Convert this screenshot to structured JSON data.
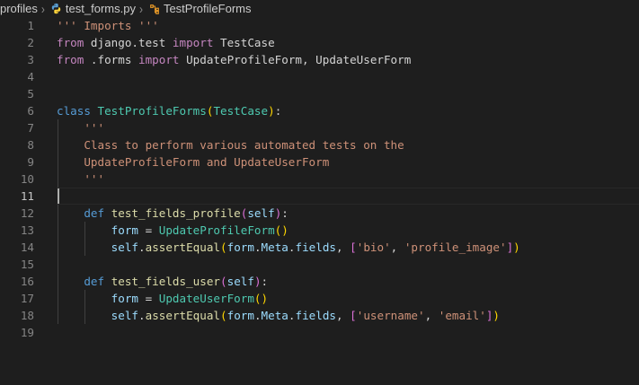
{
  "breadcrumb": {
    "folder": "profiles",
    "file": "test_forms.py",
    "symbol": "TestProfileForms"
  },
  "icons": {
    "separator": "chevron-right-icon",
    "file": "python-file-icon",
    "symbol": "class-symbol-icon"
  },
  "colors": {
    "background": "#1e1e1e",
    "keyword": "#569cd6",
    "import_keyword": "#c586c0",
    "class_name": "#4ec9b0",
    "function": "#dcdcaa",
    "string": "#ce9178",
    "variable": "#9cdcfe"
  },
  "editor": {
    "current_line": 11,
    "lines": [
      {
        "n": "1",
        "tokens": [
          {
            "t": "''' Imports '''",
            "c": "str"
          }
        ]
      },
      {
        "n": "2",
        "tokens": [
          {
            "t": "from",
            "c": "kw2"
          },
          {
            "t": " django.test "
          },
          {
            "t": "import",
            "c": "kw2"
          },
          {
            "t": " TestCase"
          }
        ]
      },
      {
        "n": "3",
        "tokens": [
          {
            "t": "from",
            "c": "kw2"
          },
          {
            "t": " .forms "
          },
          {
            "t": "import",
            "c": "kw2"
          },
          {
            "t": " UpdateProfileForm, UpdateUserForm"
          }
        ]
      },
      {
        "n": "4",
        "tokens": []
      },
      {
        "n": "5",
        "tokens": []
      },
      {
        "n": "6",
        "tokens": [
          {
            "t": "class",
            "c": "kw"
          },
          {
            "t": " "
          },
          {
            "t": "TestProfileForms",
            "c": "cls"
          },
          {
            "t": "(",
            "c": "b1"
          },
          {
            "t": "TestCase",
            "c": "cls"
          },
          {
            "t": ")",
            "c": "b1"
          },
          {
            "t": ":"
          }
        ]
      },
      {
        "n": "7",
        "tokens": [
          {
            "t": "    "
          },
          {
            "t": "'''",
            "c": "str"
          }
        ]
      },
      {
        "n": "8",
        "tokens": [
          {
            "t": "    "
          },
          {
            "t": "Class to perform various automated tests on the",
            "c": "str"
          }
        ]
      },
      {
        "n": "9",
        "tokens": [
          {
            "t": "    "
          },
          {
            "t": "UpdateProfileForm and UpdateUserForm",
            "c": "str"
          }
        ]
      },
      {
        "n": "10",
        "tokens": [
          {
            "t": "    "
          },
          {
            "t": "'''",
            "c": "str"
          }
        ]
      },
      {
        "n": "11",
        "tokens": []
      },
      {
        "n": "12",
        "tokens": [
          {
            "t": "    "
          },
          {
            "t": "def",
            "c": "kw"
          },
          {
            "t": " "
          },
          {
            "t": "test_fields_profile",
            "c": "fn"
          },
          {
            "t": "(",
            "c": "b2"
          },
          {
            "t": "self",
            "c": "var"
          },
          {
            "t": ")",
            "c": "b2"
          },
          {
            "t": ":"
          }
        ]
      },
      {
        "n": "13",
        "tokens": [
          {
            "t": "        "
          },
          {
            "t": "form",
            "c": "var"
          },
          {
            "t": " = "
          },
          {
            "t": "UpdateProfileForm",
            "c": "cls"
          },
          {
            "t": "()",
            "c": "b1"
          }
        ]
      },
      {
        "n": "14",
        "tokens": [
          {
            "t": "        "
          },
          {
            "t": "self",
            "c": "var"
          },
          {
            "t": "."
          },
          {
            "t": "assertEqual",
            "c": "fn"
          },
          {
            "t": "(",
            "c": "b1"
          },
          {
            "t": "form",
            "c": "var"
          },
          {
            "t": "."
          },
          {
            "t": "Meta",
            "c": "var"
          },
          {
            "t": "."
          },
          {
            "t": "fields",
            "c": "var"
          },
          {
            "t": ", "
          },
          {
            "t": "[",
            "c": "b2"
          },
          {
            "t": "'bio'",
            "c": "str"
          },
          {
            "t": ", "
          },
          {
            "t": "'profile_image'",
            "c": "str"
          },
          {
            "t": "]",
            "c": "b2"
          },
          {
            "t": ")",
            "c": "b1"
          }
        ]
      },
      {
        "n": "15",
        "tokens": []
      },
      {
        "n": "16",
        "tokens": [
          {
            "t": "    "
          },
          {
            "t": "def",
            "c": "kw"
          },
          {
            "t": " "
          },
          {
            "t": "test_fields_user",
            "c": "fn"
          },
          {
            "t": "(",
            "c": "b2"
          },
          {
            "t": "self",
            "c": "var"
          },
          {
            "t": ")",
            "c": "b2"
          },
          {
            "t": ":"
          }
        ]
      },
      {
        "n": "17",
        "tokens": [
          {
            "t": "        "
          },
          {
            "t": "form",
            "c": "var"
          },
          {
            "t": " = "
          },
          {
            "t": "UpdateUserForm",
            "c": "cls"
          },
          {
            "t": "()",
            "c": "b1"
          }
        ]
      },
      {
        "n": "18",
        "tokens": [
          {
            "t": "        "
          },
          {
            "t": "self",
            "c": "var"
          },
          {
            "t": "."
          },
          {
            "t": "assertEqual",
            "c": "fn"
          },
          {
            "t": "(",
            "c": "b1"
          },
          {
            "t": "form",
            "c": "var"
          },
          {
            "t": "."
          },
          {
            "t": "Meta",
            "c": "var"
          },
          {
            "t": "."
          },
          {
            "t": "fields",
            "c": "var"
          },
          {
            "t": ", "
          },
          {
            "t": "[",
            "c": "b2"
          },
          {
            "t": "'username'",
            "c": "str"
          },
          {
            "t": ", "
          },
          {
            "t": "'email'",
            "c": "str"
          },
          {
            "t": "]",
            "c": "b2"
          },
          {
            "t": ")",
            "c": "b1"
          }
        ]
      },
      {
        "n": "19",
        "tokens": []
      }
    ]
  }
}
